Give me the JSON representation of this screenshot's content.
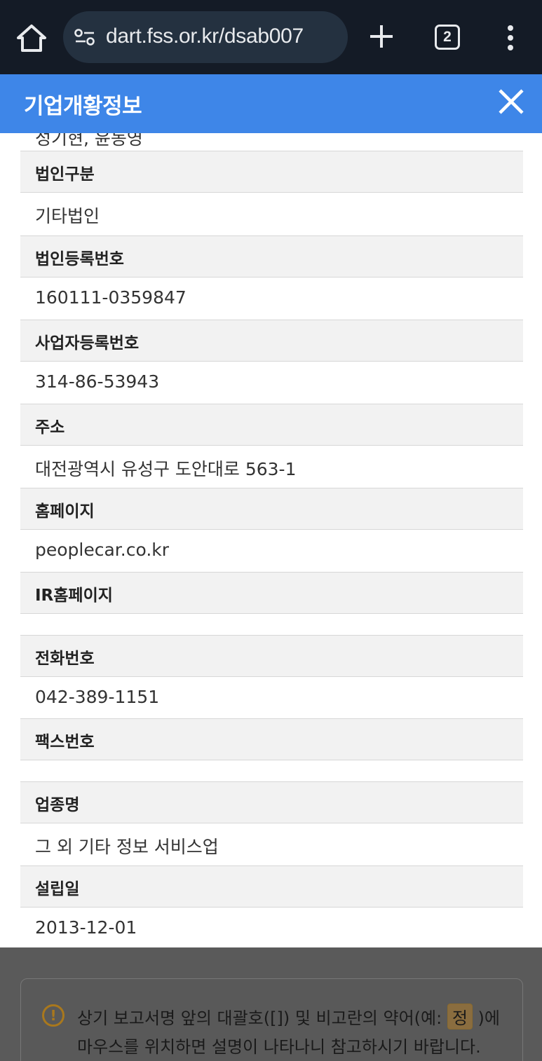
{
  "browser": {
    "url": "dart.fss.or.kr/dsab007",
    "tab_count": "2",
    "icons": {
      "home": "home-icon",
      "site_settings": "tune-icon",
      "new_tab": "plus-icon",
      "menu": "more-vert-icon"
    }
  },
  "modal": {
    "title": "기업개황정보",
    "clipped_value": "성기현, 윤동영",
    "rows": [
      {
        "label": "법인구분",
        "value": "기타법인"
      },
      {
        "label": "법인등록번호",
        "value": "160111-0359847"
      },
      {
        "label": "사업자등록번호",
        "value": "314-86-53943"
      },
      {
        "label": "주소",
        "value": "대전광역시 유성구 도안대로 563-1"
      },
      {
        "label": "홈페이지",
        "value": "peoplecar.co.kr"
      },
      {
        "label": "IR홈페이지",
        "value": ""
      },
      {
        "label": "전화번호",
        "value": "042-389-1151"
      },
      {
        "label": "팩스번호",
        "value": ""
      },
      {
        "label": "업종명",
        "value": "그 외 기타 정보 서비스업"
      },
      {
        "label": "설립일",
        "value": "2013-12-01"
      }
    ]
  },
  "note": {
    "line1_before": "상기 보고서명 앞의 대괄호([]) 및 비고란의 약어(예: ",
    "badge": "정",
    "line1_after": " )에",
    "line2": "마우스를 위치하면 설명이 나타나니 참고하시기 바랍니다.",
    "icon": "warning-icon"
  },
  "colors": {
    "chrome_bg": "#141b26",
    "url_pill_bg": "#243140",
    "header_bg": "#3e86e8",
    "row_head_bg": "#f2f2f2",
    "overlay_bg": "#5a5a5a"
  }
}
